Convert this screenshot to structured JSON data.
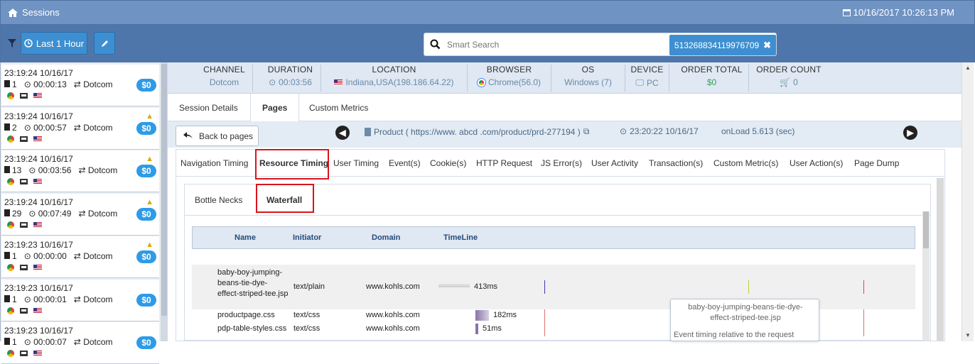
{
  "app": {
    "title": "Sessions",
    "datetime": "10/16/2017 10:26:13 PM"
  },
  "toolbar": {
    "time_filter_label": "Last 1 Hour"
  },
  "search": {
    "placeholder": "Smart Search",
    "tag": "513268834119976709"
  },
  "sessions": [
    {
      "time": "23:19:24 10/16/17",
      "pages": "1",
      "duration": "00:00:13",
      "channel": "Dotcom",
      "amount": "$0",
      "warn": false
    },
    {
      "time": "23:19:24 10/16/17",
      "pages": "2",
      "duration": "00:00:57",
      "channel": "Dotcom",
      "amount": "$0",
      "warn": true
    },
    {
      "time": "23:19:24 10/16/17",
      "pages": "13",
      "duration": "00:03:56",
      "channel": "Dotcom",
      "amount": "$0",
      "warn": true
    },
    {
      "time": "23:19:24 10/16/17",
      "pages": "29",
      "duration": "00:07:49",
      "channel": "Dotcom",
      "amount": "$0",
      "warn": true
    },
    {
      "time": "23:19:23 10/16/17",
      "pages": "1",
      "duration": "00:00:00",
      "channel": "Dotcom",
      "amount": "$0",
      "warn": true
    },
    {
      "time": "23:19:23 10/16/17",
      "pages": "1",
      "duration": "00:00:01",
      "channel": "Dotcom",
      "amount": "$0",
      "warn": false
    },
    {
      "time": "23:19:23 10/16/17",
      "pages": "1",
      "duration": "00:00:07",
      "channel": "Dotcom",
      "amount": "$0",
      "warn": false
    }
  ],
  "info": {
    "channel": {
      "label": "CHANNEL",
      "value": "Dotcom"
    },
    "duration": {
      "label": "DURATION",
      "value": "00:03:56"
    },
    "location": {
      "label": "LOCATION",
      "value": "Indiana,USA(198.186.64.22)"
    },
    "browser": {
      "label": "BROWSER",
      "value": "Chrome(56.0)"
    },
    "os": {
      "label": "OS",
      "value": "Windows (7)"
    },
    "device": {
      "label": "DEVICE",
      "value": "PC"
    },
    "order_total": {
      "label": "ORDER TOTAL",
      "value": "$0"
    },
    "order_count": {
      "label": "ORDER COUNT",
      "value": "0"
    }
  },
  "tabs": [
    "Session Details",
    "Pages",
    "Custom Metrics"
  ],
  "pagebar": {
    "back_label": "Back to pages",
    "product": "Product ( https://www. abcd .com/product/prd-277194 )",
    "time": "23:20:22 10/16/17",
    "onload": "onLoad 5.613 (sec)"
  },
  "subtabs": [
    "Navigation Timing",
    "Resource Timing",
    "User Timing",
    "Event(s)",
    "Cookie(s)",
    "HTTP Request",
    "JS Error(s)",
    "User Activity",
    "Transaction(s)",
    "Custom Metric(s)",
    "User Action(s)",
    "Page Dump"
  ],
  "innertabs": [
    "Bottle Necks",
    "Waterfall"
  ],
  "waterfall": {
    "headers": [
      "Name",
      "Initiator",
      "Domain",
      "TimeLine"
    ],
    "rows": [
      {
        "name": "baby-boy-jumping-beans-tie-dye-effect-striped-tee.jsp",
        "initiator": "text/plain",
        "domain": "www.kohls.com",
        "time": "413ms"
      },
      {
        "name": "productpage.css",
        "initiator": "text/css",
        "domain": "www.kohls.com",
        "time": "182ms"
      },
      {
        "name": "pdp-table-styles.css",
        "initiator": "text/css",
        "domain": "www.kohls.com",
        "time": "51ms"
      }
    ],
    "tooltip_title": "baby-boy-jumping-beans-tie-dye-effect-striped-tee.jsp",
    "tooltip_body": "Event timing relative to the request"
  }
}
